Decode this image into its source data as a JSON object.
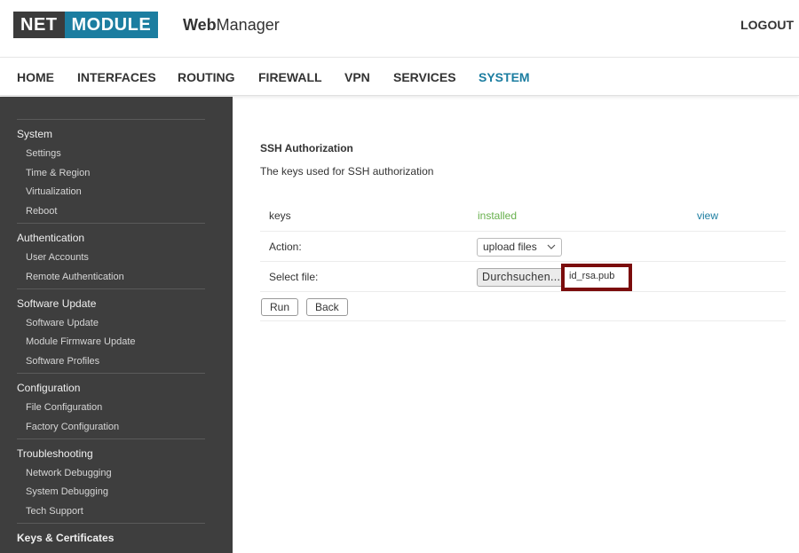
{
  "header": {
    "logo_left": "NET",
    "logo_right": "MODULE",
    "app_name_bold": "Web",
    "app_name_rest": "Manager",
    "logout": "LOGOUT"
  },
  "nav": {
    "items": [
      "HOME",
      "INTERFACES",
      "ROUTING",
      "FIREWALL",
      "VPN",
      "SERVICES",
      "SYSTEM"
    ],
    "active": "SYSTEM"
  },
  "sidebar": {
    "sections": [
      {
        "title": "System",
        "items": [
          "Settings",
          "Time & Region",
          "Virtualization",
          "Reboot"
        ]
      },
      {
        "title": "Authentication",
        "items": [
          "User Accounts",
          "Remote Authentication"
        ]
      },
      {
        "title": "Software Update",
        "items": [
          "Software Update",
          "Module Firmware Update",
          "Software Profiles"
        ]
      },
      {
        "title": "Configuration",
        "items": [
          "File Configuration",
          "Factory Configuration"
        ]
      },
      {
        "title": "Troubleshooting",
        "items": [
          "Network Debugging",
          "System Debugging",
          "Tech Support"
        ]
      },
      {
        "title": "Keys & Certificates",
        "items": []
      }
    ]
  },
  "main": {
    "title": "SSH Authorization",
    "description": "The keys used for SSH authorization",
    "keys_label": "keys",
    "keys_status": "installed",
    "keys_link": "view",
    "action_label": "Action:",
    "action_value": "upload files",
    "select_file_label": "Select file:",
    "browse_button": "Durchsuchen...",
    "selected_file": "id_rsa.pub",
    "run_button": "Run",
    "back_button": "Back"
  },
  "colors": {
    "brand_dark": "#3b3b3b",
    "brand_accent": "#1b7da0",
    "sidebar_bg": "#3e3e3e",
    "status_green": "#67b04c",
    "highlight_border": "#7b0c0c"
  }
}
